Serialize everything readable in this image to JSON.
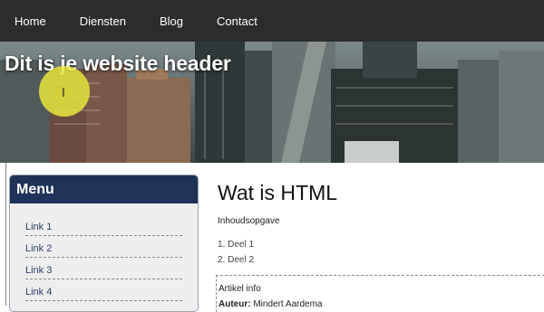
{
  "nav": {
    "items": [
      {
        "label": "Home"
      },
      {
        "label": "Diensten"
      },
      {
        "label": "Blog"
      },
      {
        "label": "Contact"
      }
    ]
  },
  "header": {
    "title": "Dit is je website header"
  },
  "sidebar": {
    "heading": "Menu",
    "links": [
      {
        "label": "Link 1"
      },
      {
        "label": "Link 2"
      },
      {
        "label": "Link 3"
      },
      {
        "label": "Link 4"
      }
    ]
  },
  "main": {
    "title": "Wat is HTML",
    "toc_label": "Inhoudsopgave",
    "toc": [
      {
        "label": "1. Deel 1"
      },
      {
        "label": "2. Deel 2"
      }
    ],
    "article_info": {
      "title": "Artikel info",
      "author_label": "Auteur:",
      "author_name": "Mindert Aardema"
    }
  },
  "colors": {
    "nav_bg": "#2c2c2c",
    "sidebar_header": "#1f3358",
    "sidebar_bg": "#eeeeee",
    "cursor_highlight": "#e6e63c"
  },
  "icons": {
    "text_cursor": "text-cursor-icon"
  }
}
